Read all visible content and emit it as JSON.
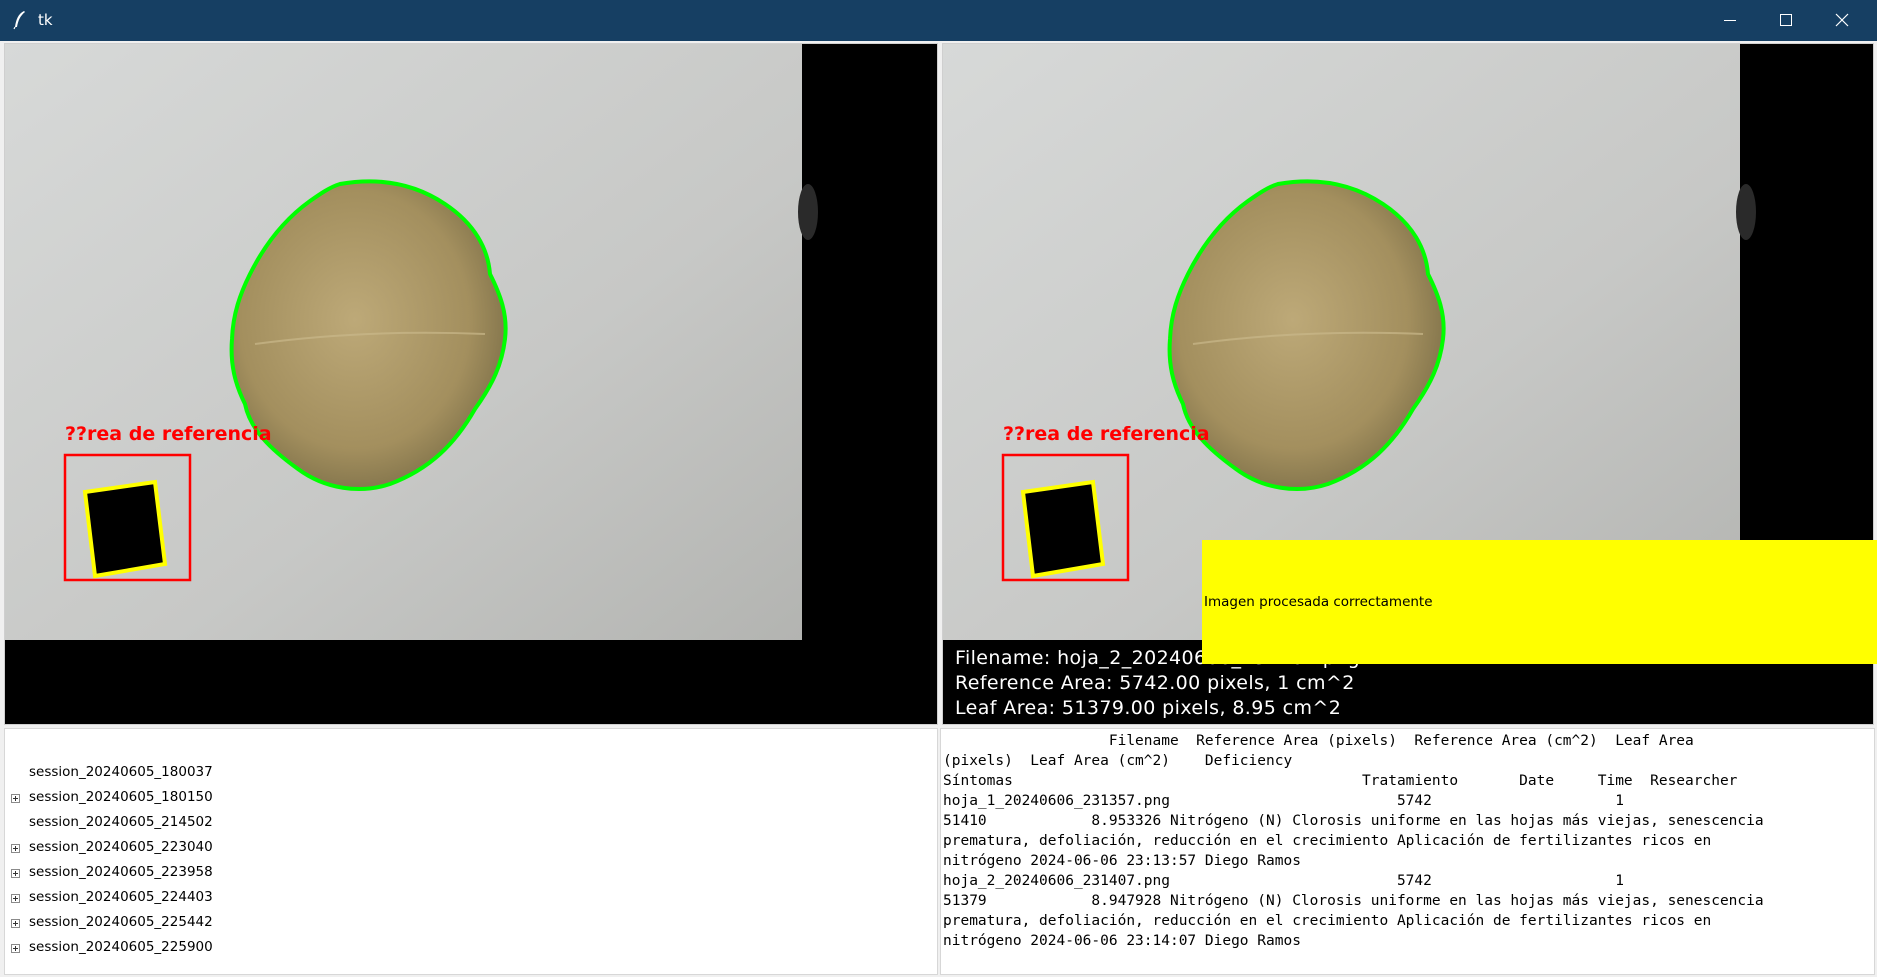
{
  "window": {
    "title": "tk"
  },
  "titlebar": {
    "minimize_icon": "minimize-icon",
    "maximize_icon": "maximize-icon",
    "close_icon": "close-icon"
  },
  "left_image": {
    "reference_label": "??rea de referencia"
  },
  "right_image": {
    "reference_label": "??rea de referencia",
    "overlay_lines": [
      "Filename: hoja_2_20240606_231407.png",
      "Reference Area: 5742.00 pixels, 1 cm^2",
      "Leaf Area: 51379.00 pixels, 8.95 cm^2"
    ]
  },
  "status": {
    "message": "Imagen procesada correctamente",
    "color": "#ffff00"
  },
  "tree": {
    "items": [
      {
        "label": "session_20240605_180037",
        "expandable": false
      },
      {
        "label": "session_20240605_180150",
        "expandable": true
      },
      {
        "label": "session_20240605_214502",
        "expandable": false
      },
      {
        "label": "session_20240605_223040",
        "expandable": true
      },
      {
        "label": "session_20240605_223958",
        "expandable": true
      },
      {
        "label": "session_20240605_224403",
        "expandable": true
      },
      {
        "label": "session_20240605_225442",
        "expandable": true
      },
      {
        "label": "session_20240605_225900",
        "expandable": true
      }
    ]
  },
  "results_text": {
    "lines": [
      "                   Filename  Reference Area (pixels)  Reference Area (cm^2)  Leaf Area",
      "(pixels)  Leaf Area (cm^2)    Deficiency",
      "Síntomas                                        Tratamiento       Date     Time  Researcher",
      "hoja_1_20240606_231357.png                          5742                     1",
      "51410            8.953326 Nitrógeno (N) Clorosis uniforme en las hojas más viejas, senescencia",
      "prematura, defoliación, reducción en el crecimiento Aplicación de fertilizantes ricos en",
      "nitrógeno 2024-06-06 23:13:57 Diego Ramos",
      "hoja_2_20240606_231407.png                          5742                     1",
      "51379            8.947928 Nitrógeno (N) Clorosis uniforme en las hojas más viejas, senescencia",
      "prematura, defoliación, reducción en el crecimiento Aplicación de fertilizantes ricos en",
      "nitrógeno 2024-06-06 23:14:07 Diego Ramos"
    ]
  },
  "colors": {
    "titlebar": "#163f63",
    "contour": "#00ff00",
    "reference_box": "#ff0000",
    "reference_contour": "#ffff00"
  }
}
